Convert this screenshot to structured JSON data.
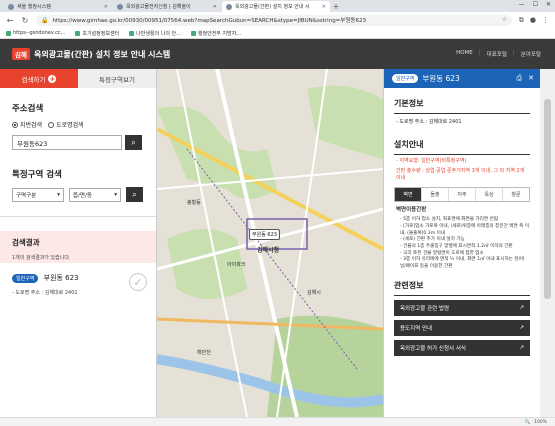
{
  "browser": {
    "tabs": [
      {
        "label": "새올 행정시스템",
        "active": false
      },
      {
        "label": "옥외광고물전자신청 | 김해올이",
        "active": false
      },
      {
        "label": "옥외광고물(간판) 설치 정보 안내 시",
        "active": true
      }
    ],
    "url": "https://www.gimhae.go.kr/00930/00951/07564.web?mapSearchGubun=SEARCH&stype=JIBUN&sstring=부원동623",
    "bookmarks": [
      "https--gsndonev.cc...",
      "초기설정정보센터",
      "나만생활의 나의 안...",
      "행정안전부 지방자..."
    ],
    "zoom": "100%"
  },
  "site": {
    "logo": "김해",
    "title": "옥외광고물(간판) 설치 정보 안내 시스템",
    "links": [
      "HOME",
      "대표포털",
      "분야포털"
    ]
  },
  "left": {
    "tab_search": "검색하기",
    "tab_special": "특정구역보기",
    "address_title": "주소검색",
    "radio_jibun": "지번검색",
    "radio_road": "도로명검색",
    "search_value": "부원동623",
    "special_title": "특정구역 검색",
    "select_area": "구역구분",
    "select_dong": "읍/면/동",
    "result_title": "검색결과",
    "result_count": "1개의 검색결과가 있습니다.",
    "result_badge": "일반구역",
    "result_name": "부원동 623",
    "result_addr": "- 도로명 주소 : 김해대로 2401"
  },
  "map": {
    "labels": [
      "김해시청",
      "부원동 623",
      "아이파크",
      "봉황동",
      "김해시",
      "해반천"
    ]
  },
  "right": {
    "badge": "일반구역",
    "name": "부원동 623",
    "basic_title": "기본정보",
    "basic_addr": "- 도로명 주소 : 김해대로 2401",
    "install_title": "설치안내",
    "zone_line": "- 지역요형: 일반구역(비특정구역)",
    "zone_desc": "간판 총수량 : 상업·공업·준주거지역 3개 이내, 그 외 지역 2개 이내",
    "tabs": [
      "벽면",
      "돌출",
      "지주",
      "옥상",
      "창문"
    ],
    "rules_title": "벽면이용간판",
    "rules": [
      "- 5층 이하 업소 설치, 좌표면에 화면을 가리면 안됨",
      "- [가로]업소 가로폭 이내, (세로)위층에 아래층의 창문간 벽면 폭 이내, (돌출폭)0.3m 이내",
      "- (세로) 간판 추가 이내 설치 가능",
      "- 건물의 1층 주출입구 양옆에 표시면적 1.2㎡ 이하의 간판",
      "- 곡각 토픈 건물 말릴면이 도로에 접한 업소",
      "- 3층 이하 유리에에 면적 ¼ 이내, 화면 1㎡ 이내 표시하는 천/비닐/페이프 등을 이용한 간판"
    ],
    "related_title": "관련정보",
    "related": [
      "옥외광고물 관련 법령",
      "용도지역 안내",
      "옥외광고물 허가 신청서 서식"
    ]
  },
  "colors": {
    "accent": "#e8432e",
    "blue": "#1c64b8",
    "header": "#3a3a3a"
  }
}
